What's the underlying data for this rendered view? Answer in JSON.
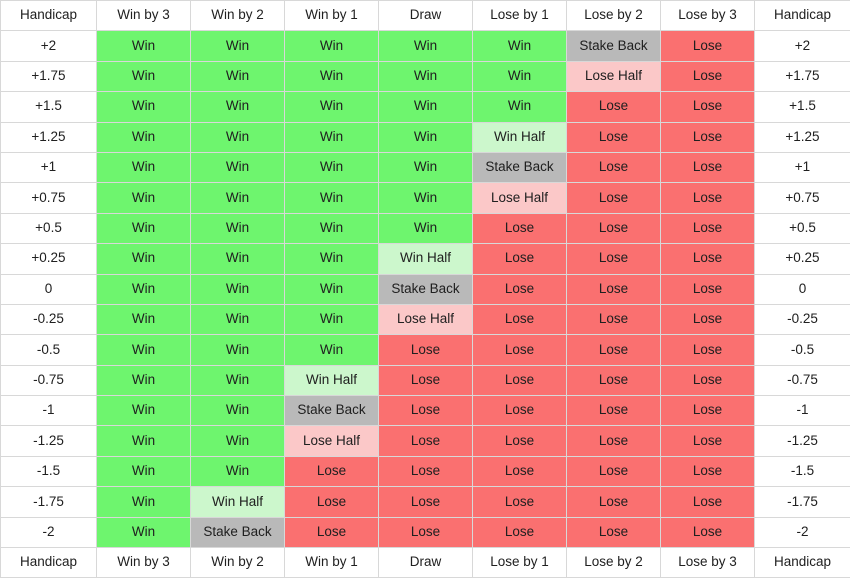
{
  "table": {
    "name": "asian-handicap-outcome-table",
    "columns": [
      "Handicap",
      "Win by 3",
      "Win by 2",
      "Win by 1",
      "Draw",
      "Lose by 1",
      "Lose by 2",
      "Lose by 3",
      "Handicap"
    ],
    "footer_columns": [
      "Handicap",
      "Win by 3",
      "Win by 2",
      "Win by 1",
      "Draw",
      "Lose by 1",
      "Lose by 2",
      "Lose by 3",
      "Handicap"
    ],
    "outcome_colors": {
      "Win": "#6ef56e",
      "Win Half": "#ccf7cc",
      "Stake Back": "#b9b9b9",
      "Lose Half": "#fbc8c8",
      "Lose": "#fa7070"
    },
    "rows": [
      {
        "handicap": "+2",
        "cells": [
          "Win",
          "Win",
          "Win",
          "Win",
          "Win",
          "Stake Back",
          "Lose"
        ]
      },
      {
        "handicap": "+1.75",
        "cells": [
          "Win",
          "Win",
          "Win",
          "Win",
          "Win",
          "Lose Half",
          "Lose"
        ]
      },
      {
        "handicap": "+1.5",
        "cells": [
          "Win",
          "Win",
          "Win",
          "Win",
          "Win",
          "Lose",
          "Lose"
        ]
      },
      {
        "handicap": "+1.25",
        "cells": [
          "Win",
          "Win",
          "Win",
          "Win",
          "Win Half",
          "Lose",
          "Lose"
        ]
      },
      {
        "handicap": "+1",
        "cells": [
          "Win",
          "Win",
          "Win",
          "Win",
          "Stake Back",
          "Lose",
          "Lose"
        ]
      },
      {
        "handicap": "+0.75",
        "cells": [
          "Win",
          "Win",
          "Win",
          "Win",
          "Lose Half",
          "Lose",
          "Lose"
        ]
      },
      {
        "handicap": "+0.5",
        "cells": [
          "Win",
          "Win",
          "Win",
          "Win",
          "Lose",
          "Lose",
          "Lose"
        ]
      },
      {
        "handicap": "+0.25",
        "cells": [
          "Win",
          "Win",
          "Win",
          "Win Half",
          "Lose",
          "Lose",
          "Lose"
        ]
      },
      {
        "handicap": "0",
        "cells": [
          "Win",
          "Win",
          "Win",
          "Stake Back",
          "Lose",
          "Lose",
          "Lose"
        ]
      },
      {
        "handicap": "-0.25",
        "cells": [
          "Win",
          "Win",
          "Win",
          "Lose Half",
          "Lose",
          "Lose",
          "Lose"
        ]
      },
      {
        "handicap": "-0.5",
        "cells": [
          "Win",
          "Win",
          "Win",
          "Lose",
          "Lose",
          "Lose",
          "Lose"
        ]
      },
      {
        "handicap": "-0.75",
        "cells": [
          "Win",
          "Win",
          "Win Half",
          "Lose",
          "Lose",
          "Lose",
          "Lose"
        ]
      },
      {
        "handicap": "-1",
        "cells": [
          "Win",
          "Win",
          "Stake Back",
          "Lose",
          "Lose",
          "Lose",
          "Lose"
        ]
      },
      {
        "handicap": "-1.25",
        "cells": [
          "Win",
          "Win",
          "Lose Half",
          "Lose",
          "Lose",
          "Lose",
          "Lose"
        ]
      },
      {
        "handicap": "-1.5",
        "cells": [
          "Win",
          "Win",
          "Lose",
          "Lose",
          "Lose",
          "Lose",
          "Lose"
        ]
      },
      {
        "handicap": "-1.75",
        "cells": [
          "Win",
          "Win Half",
          "Lose",
          "Lose",
          "Lose",
          "Lose",
          "Lose"
        ]
      },
      {
        "handicap": "-2",
        "cells": [
          "Win",
          "Stake Back",
          "Lose",
          "Lose",
          "Lose",
          "Lose",
          "Lose"
        ]
      }
    ]
  }
}
